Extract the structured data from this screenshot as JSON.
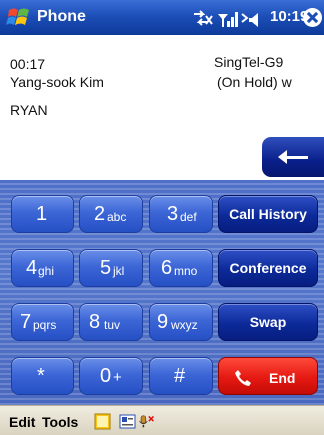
{
  "titlebar": {
    "app_title": "Phone",
    "clock": "10:19",
    "icons": [
      "windows-start-icon",
      "connectivity-icon",
      "signal-icon",
      "volume-icon",
      "close-icon"
    ]
  },
  "call": {
    "duration": "00:17",
    "caller_name": "Yang-sook Kim",
    "contact_label": "RYAN",
    "carrier": "SingTel-G9",
    "hold_status": "(On Hold) w"
  },
  "keypad": {
    "keys": [
      {
        "digit": "1",
        "letters": ""
      },
      {
        "digit": "2",
        "letters": "abc"
      },
      {
        "digit": "3",
        "letters": "def"
      },
      {
        "digit": "4",
        "letters": "ghi"
      },
      {
        "digit": "5",
        "letters": "jkl"
      },
      {
        "digit": "6",
        "letters": "mno"
      },
      {
        "digit": "7",
        "letters": "pqrs"
      },
      {
        "digit": "8",
        "letters": "tuv"
      },
      {
        "digit": "9",
        "letters": "wxyz"
      },
      {
        "digit": "*",
        "letters": ""
      },
      {
        "digit": "0",
        "letters": "+"
      },
      {
        "digit": "#",
        "letters": ""
      }
    ],
    "call_history": "Call History",
    "conference": "Conference",
    "swap": "Swap",
    "end": "End"
  },
  "menubar": {
    "edit": "Edit",
    "tools": "Tools",
    "icons": [
      "notes-icon",
      "contact-card-icon",
      "microphone-mute-icon"
    ]
  },
  "colors": {
    "titlebar": "#1d4fb8",
    "key_blue": "#3d66d6",
    "fn_navy": "#0c2a99",
    "end_red": "#e51912"
  }
}
